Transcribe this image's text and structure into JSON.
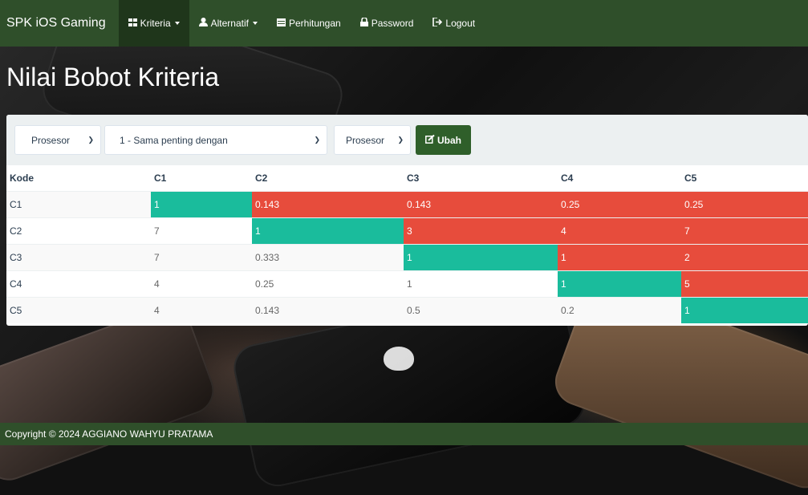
{
  "navbar": {
    "brand": "SPK iOS Gaming",
    "items": [
      {
        "label": "Kriteria",
        "icon": "grid-icon",
        "dropdown": true,
        "active": true
      },
      {
        "label": "Alternatif",
        "icon": "user-icon",
        "dropdown": true,
        "active": false
      },
      {
        "label": "Perhitungan",
        "icon": "calendar-icon",
        "dropdown": false,
        "active": false
      },
      {
        "label": "Password",
        "icon": "lock-icon",
        "dropdown": false,
        "active": false
      },
      {
        "label": "Logout",
        "icon": "logout-icon",
        "dropdown": false,
        "active": false
      }
    ]
  },
  "page_title": "Nilai Bobot Kriteria",
  "form": {
    "criteria_left": "Prosesor",
    "comparison": "1 - Sama penting dengan",
    "criteria_right": "Prosesor",
    "submit_label": "Ubah"
  },
  "table": {
    "headers": [
      "Kode",
      "C1",
      "C2",
      "C3",
      "C4",
      "C5"
    ],
    "rows": [
      {
        "code": "C1",
        "values": [
          "1",
          "0.143",
          "0.143",
          "0.25",
          "0.25"
        ]
      },
      {
        "code": "C2",
        "values": [
          "7",
          "1",
          "3",
          "4",
          "7"
        ]
      },
      {
        "code": "C3",
        "values": [
          "7",
          "0.333",
          "1",
          "1",
          "2"
        ]
      },
      {
        "code": "C4",
        "values": [
          "4",
          "0.25",
          "1",
          "1",
          "5"
        ]
      },
      {
        "code": "C5",
        "values": [
          "4",
          "0.143",
          "0.5",
          "0.2",
          "1"
        ]
      }
    ]
  },
  "footer": "Copyright © 2024 AGGIANO WAHYU PRATAMA",
  "colors": {
    "navbar": "#2f4f2a",
    "diagonal": "#1abc9c",
    "upper": "#e74c3c"
  }
}
